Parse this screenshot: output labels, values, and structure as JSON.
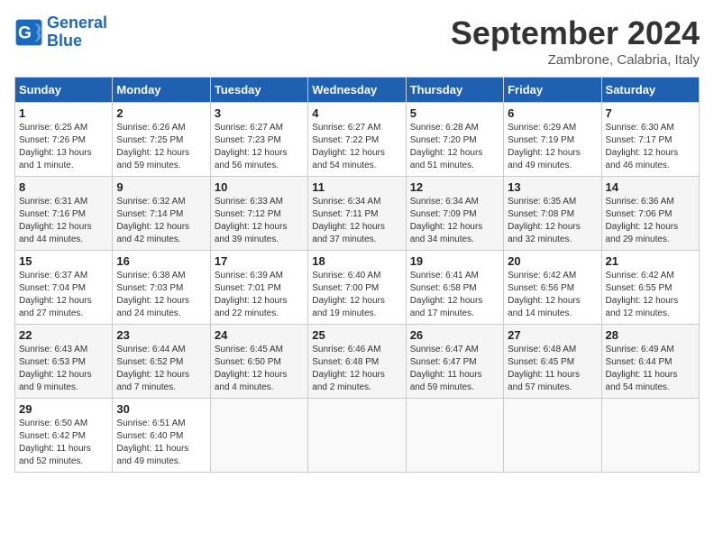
{
  "logo": {
    "line1": "General",
    "line2": "Blue"
  },
  "title": "September 2024",
  "subtitle": "Zambrone, Calabria, Italy",
  "days_of_week": [
    "Sunday",
    "Monday",
    "Tuesday",
    "Wednesday",
    "Thursday",
    "Friday",
    "Saturday"
  ],
  "weeks": [
    [
      {
        "day": "1",
        "info": "Sunrise: 6:25 AM\nSunset: 7:26 PM\nDaylight: 13 hours\nand 1 minute."
      },
      {
        "day": "2",
        "info": "Sunrise: 6:26 AM\nSunset: 7:25 PM\nDaylight: 12 hours\nand 59 minutes."
      },
      {
        "day": "3",
        "info": "Sunrise: 6:27 AM\nSunset: 7:23 PM\nDaylight: 12 hours\nand 56 minutes."
      },
      {
        "day": "4",
        "info": "Sunrise: 6:27 AM\nSunset: 7:22 PM\nDaylight: 12 hours\nand 54 minutes."
      },
      {
        "day": "5",
        "info": "Sunrise: 6:28 AM\nSunset: 7:20 PM\nDaylight: 12 hours\nand 51 minutes."
      },
      {
        "day": "6",
        "info": "Sunrise: 6:29 AM\nSunset: 7:19 PM\nDaylight: 12 hours\nand 49 minutes."
      },
      {
        "day": "7",
        "info": "Sunrise: 6:30 AM\nSunset: 7:17 PM\nDaylight: 12 hours\nand 46 minutes."
      }
    ],
    [
      {
        "day": "8",
        "info": "Sunrise: 6:31 AM\nSunset: 7:16 PM\nDaylight: 12 hours\nand 44 minutes."
      },
      {
        "day": "9",
        "info": "Sunrise: 6:32 AM\nSunset: 7:14 PM\nDaylight: 12 hours\nand 42 minutes."
      },
      {
        "day": "10",
        "info": "Sunrise: 6:33 AM\nSunset: 7:12 PM\nDaylight: 12 hours\nand 39 minutes."
      },
      {
        "day": "11",
        "info": "Sunrise: 6:34 AM\nSunset: 7:11 PM\nDaylight: 12 hours\nand 37 minutes."
      },
      {
        "day": "12",
        "info": "Sunrise: 6:34 AM\nSunset: 7:09 PM\nDaylight: 12 hours\nand 34 minutes."
      },
      {
        "day": "13",
        "info": "Sunrise: 6:35 AM\nSunset: 7:08 PM\nDaylight: 12 hours\nand 32 minutes."
      },
      {
        "day": "14",
        "info": "Sunrise: 6:36 AM\nSunset: 7:06 PM\nDaylight: 12 hours\nand 29 minutes."
      }
    ],
    [
      {
        "day": "15",
        "info": "Sunrise: 6:37 AM\nSunset: 7:04 PM\nDaylight: 12 hours\nand 27 minutes."
      },
      {
        "day": "16",
        "info": "Sunrise: 6:38 AM\nSunset: 7:03 PM\nDaylight: 12 hours\nand 24 minutes."
      },
      {
        "day": "17",
        "info": "Sunrise: 6:39 AM\nSunset: 7:01 PM\nDaylight: 12 hours\nand 22 minutes."
      },
      {
        "day": "18",
        "info": "Sunrise: 6:40 AM\nSunset: 7:00 PM\nDaylight: 12 hours\nand 19 minutes."
      },
      {
        "day": "19",
        "info": "Sunrise: 6:41 AM\nSunset: 6:58 PM\nDaylight: 12 hours\nand 17 minutes."
      },
      {
        "day": "20",
        "info": "Sunrise: 6:42 AM\nSunset: 6:56 PM\nDaylight: 12 hours\nand 14 minutes."
      },
      {
        "day": "21",
        "info": "Sunrise: 6:42 AM\nSunset: 6:55 PM\nDaylight: 12 hours\nand 12 minutes."
      }
    ],
    [
      {
        "day": "22",
        "info": "Sunrise: 6:43 AM\nSunset: 6:53 PM\nDaylight: 12 hours\nand 9 minutes."
      },
      {
        "day": "23",
        "info": "Sunrise: 6:44 AM\nSunset: 6:52 PM\nDaylight: 12 hours\nand 7 minutes."
      },
      {
        "day": "24",
        "info": "Sunrise: 6:45 AM\nSunset: 6:50 PM\nDaylight: 12 hours\nand 4 minutes."
      },
      {
        "day": "25",
        "info": "Sunrise: 6:46 AM\nSunset: 6:48 PM\nDaylight: 12 hours\nand 2 minutes."
      },
      {
        "day": "26",
        "info": "Sunrise: 6:47 AM\nSunset: 6:47 PM\nDaylight: 11 hours\nand 59 minutes."
      },
      {
        "day": "27",
        "info": "Sunrise: 6:48 AM\nSunset: 6:45 PM\nDaylight: 11 hours\nand 57 minutes."
      },
      {
        "day": "28",
        "info": "Sunrise: 6:49 AM\nSunset: 6:44 PM\nDaylight: 11 hours\nand 54 minutes."
      }
    ],
    [
      {
        "day": "29",
        "info": "Sunrise: 6:50 AM\nSunset: 6:42 PM\nDaylight: 11 hours\nand 52 minutes."
      },
      {
        "day": "30",
        "info": "Sunrise: 6:51 AM\nSunset: 6:40 PM\nDaylight: 11 hours\nand 49 minutes."
      },
      {
        "day": "",
        "info": ""
      },
      {
        "day": "",
        "info": ""
      },
      {
        "day": "",
        "info": ""
      },
      {
        "day": "",
        "info": ""
      },
      {
        "day": "",
        "info": ""
      }
    ]
  ]
}
